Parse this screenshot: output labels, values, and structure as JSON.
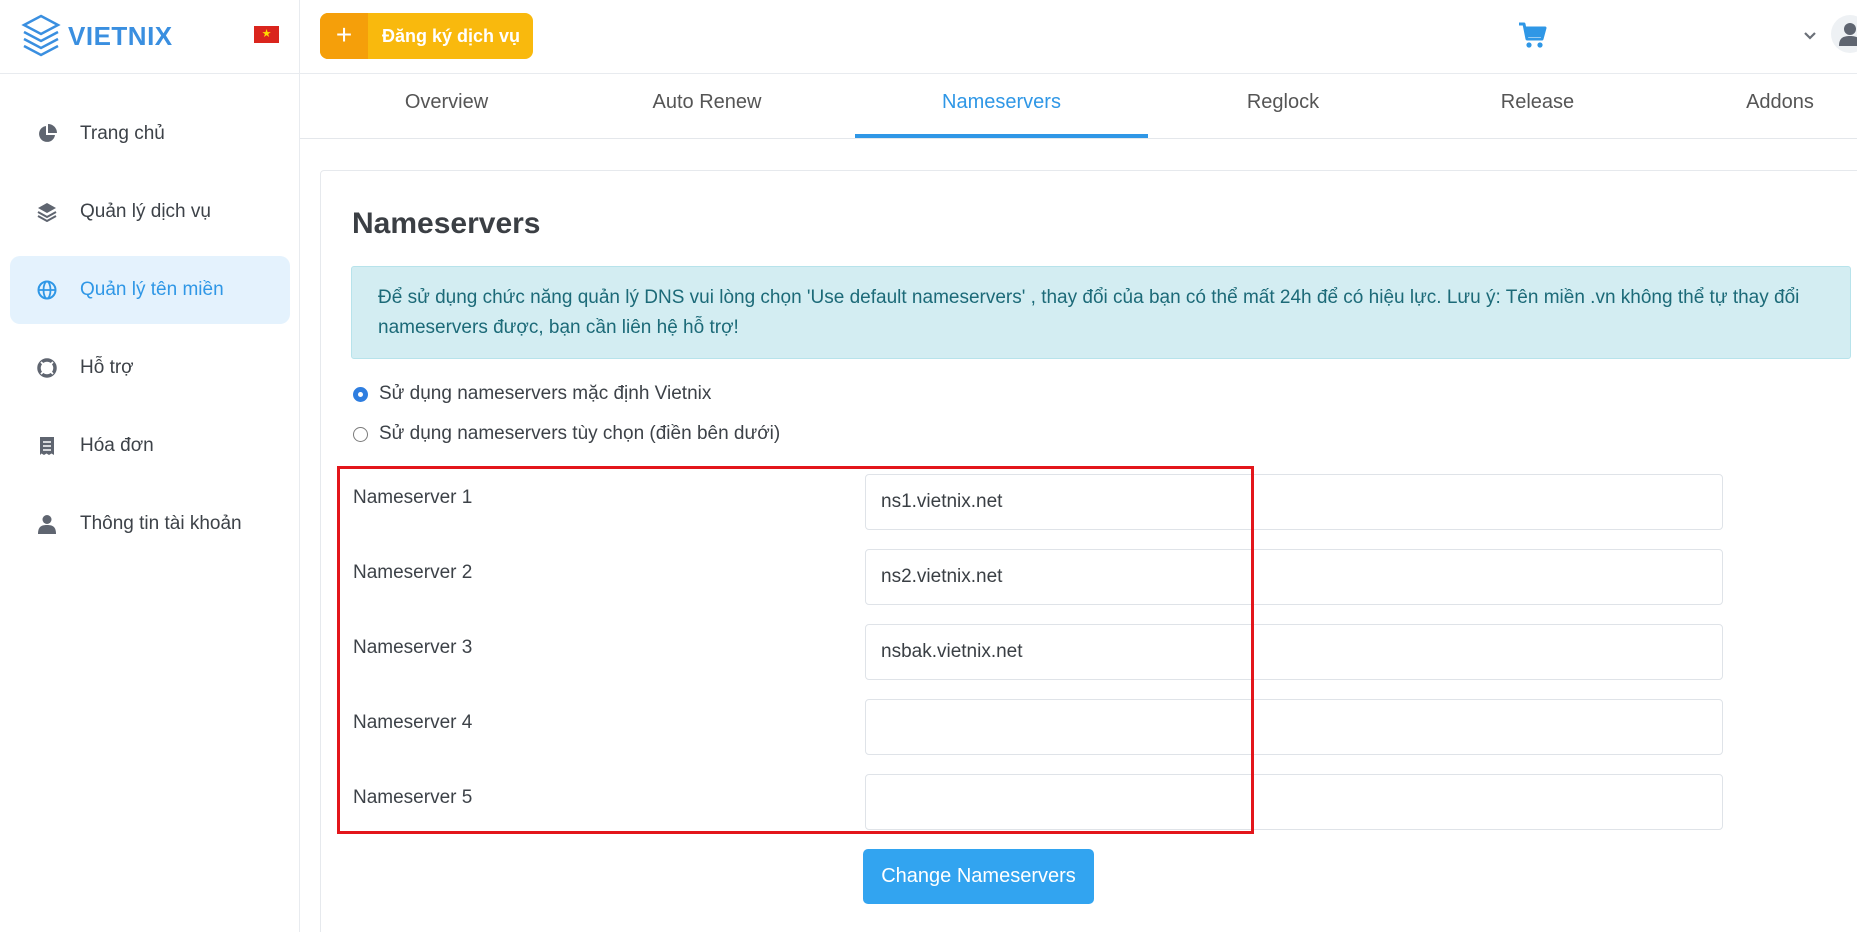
{
  "brand": {
    "name": "VIETNIX",
    "flag_icon": "vietnam-flag-icon"
  },
  "topbar": {
    "register_label": "Đăng ký dịch vụ",
    "register_icon": "plus-icon",
    "cart_icon": "cart-icon",
    "user_icon": "user-icon"
  },
  "sidebar": {
    "items": [
      {
        "label": "Trang chủ",
        "icon": "pie-chart-icon",
        "active": false
      },
      {
        "label": "Quản lý dịch vụ",
        "icon": "layers-icon",
        "active": false
      },
      {
        "label": "Quản lý tên miền",
        "icon": "globe-icon",
        "active": true
      },
      {
        "label": "Hỗ trợ",
        "icon": "lifebuoy-icon",
        "active": false
      },
      {
        "label": "Hóa đơn",
        "icon": "receipt-icon",
        "active": false
      },
      {
        "label": "Thông tin tài khoản",
        "icon": "user-icon",
        "active": false
      }
    ]
  },
  "tabs": [
    {
      "label": "Overview",
      "active": false
    },
    {
      "label": "Auto Renew",
      "active": false
    },
    {
      "label": "Nameservers",
      "active": true
    },
    {
      "label": "Reglock",
      "active": false
    },
    {
      "label": "Release",
      "active": false
    },
    {
      "label": "Addons",
      "active": false
    }
  ],
  "main": {
    "title": "Nameservers",
    "alert": "Để sử dụng chức năng quản lý DNS vui lòng chọn 'Use default nameservers' , thay đổi của bạn có thể mất 24h để có hiệu lực. Lưu ý: Tên miền .vn không thể tự thay đổi nameservers được, bạn cần liên hệ hỗ trợ!",
    "radio_default": {
      "label": "Sử dụng nameservers mặc định Vietnix",
      "checked": true
    },
    "radio_custom": {
      "label": "Sử dụng nameservers tùy chọn (điền bên dưới)",
      "checked": false
    },
    "nameservers": [
      {
        "label": "Nameserver 1",
        "value": "ns1.vietnix.net"
      },
      {
        "label": "Nameserver 2",
        "value": "ns2.vietnix.net"
      },
      {
        "label": "Nameserver 3",
        "value": "nsbak.vietnix.net"
      },
      {
        "label": "Nameserver 4",
        "value": ""
      },
      {
        "label": "Nameserver 5",
        "value": ""
      }
    ],
    "submit_label": "Change Nameservers"
  },
  "colors": {
    "accent": "#2f97e6",
    "register": "#f9b90d",
    "alert_bg": "#d3edf2",
    "highlight": "#e3161b"
  }
}
